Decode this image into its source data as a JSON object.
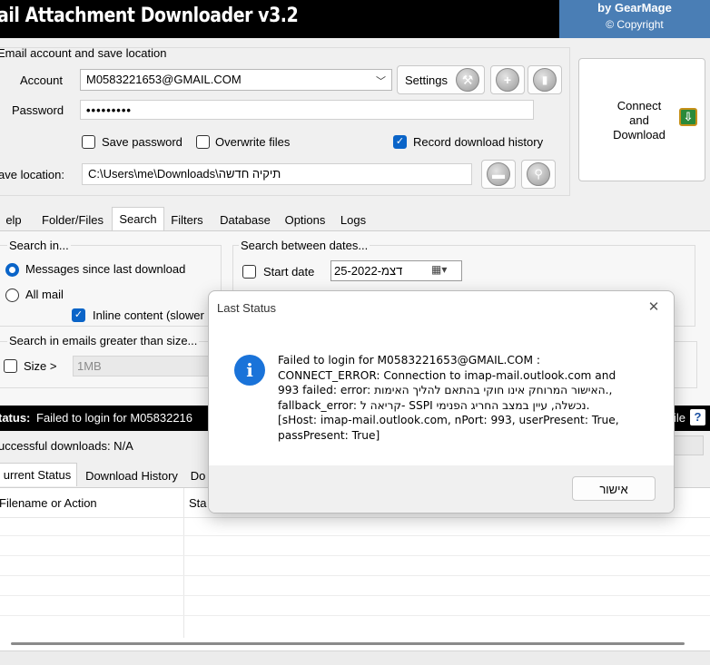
{
  "titlebar": {
    "app_title": "ail Attachment Downloader v3.2",
    "brand_by": "by GearMage",
    "brand_copyright": "© Copyright"
  },
  "account_group": {
    "title": "Email account and save location",
    "account_label": "Account",
    "account_value": "M0583221653@GMAIL.COM",
    "settings_label": "Settings",
    "password_label": "Password",
    "password_value": "•••••••••",
    "save_password_label": "Save password",
    "overwrite_files_label": "Overwrite files",
    "record_history_label": "Record download history",
    "save_location_label": "ave location:",
    "save_location_value": "C:\\Users\\me\\Downloads\\תיקיה חדשה"
  },
  "connect": {
    "line1": "Connect",
    "line2": "and",
    "line3": "Download"
  },
  "tabs": [
    "elp",
    "Folder/Files",
    "Search",
    "Filters",
    "Database",
    "Options",
    "Logs"
  ],
  "search_tab": {
    "search_in_title": "Search in...",
    "since_last_label": "Messages since last download",
    "all_mail_label": "All mail",
    "inline_label": "Inline content (slower",
    "size_group_title": "Search in emails greater than size...",
    "size_label": "Size >",
    "size_value": "1MB",
    "dates_title": "Search between dates...",
    "start_date_label": "Start date",
    "start_date_value": "25-דצמ-2022"
  },
  "status": {
    "label": "tatus:",
    "text": "Failed to login for M05832216",
    "right_text": "ile",
    "help_glyph": "?",
    "successful": "uccessful downloads: N/A"
  },
  "bottom_tabs": [
    "urrent Status",
    "Download History",
    "Do"
  ],
  "grid": {
    "col_filename": "Filename or Action",
    "col_status": "Sta"
  },
  "dialog": {
    "title": "Last Status",
    "close_glyph": "✕",
    "ok_label": "אישור",
    "lines": [
      "Failed to login for M0583221653@GMAIL.COM :",
      "CONNECT_ERROR: Connection to imap-mail.outlook.com and",
      "993 failed: error: האישור המרוחק אינו חוקי בהתאם להליך האימות.,",
      "fallback_error: קריאה ל- SSPI נכשלה, עיין במצב החריג הפנימי.",
      "[sHost: imap-mail.outlook.com, nPort: 993, userPresent: True,",
      "passPresent: True]"
    ]
  }
}
